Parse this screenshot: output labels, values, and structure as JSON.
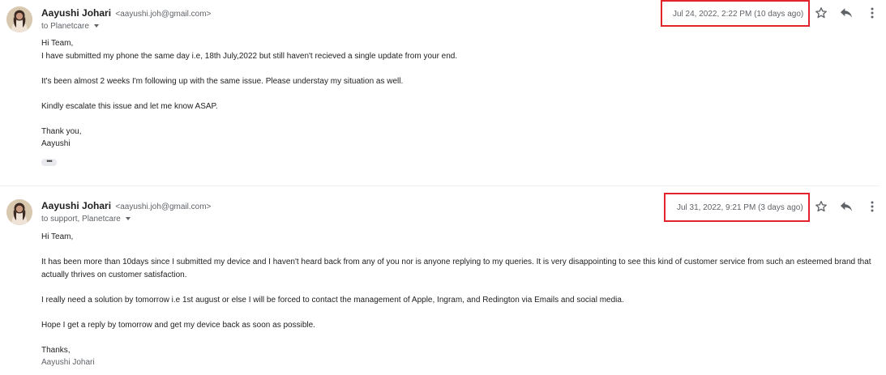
{
  "messages": [
    {
      "sender_name": "Aayushi Johari",
      "sender_email": "<aayushi.joh@gmail.com>",
      "recipients": "to Planetcare",
      "date": "Jul 24, 2022, 2:22 PM (10 days ago)",
      "body": [
        "Hi Team,",
        "I have submitted my phone the same day i.e, 18th July,2022 but still haven't recieved a single update from your end.",
        "It's been almost 2 weeks I'm following up with the same issue. Please understay my situation as well.",
        "Kindly escalate this issue and let me know ASAP.",
        "Thank you,",
        "Aayushi"
      ],
      "collapsed_label": "•••",
      "icons": [
        "star-icon",
        "reply-icon",
        "more-vert-icon"
      ]
    },
    {
      "sender_name": "Aayushi Johari",
      "sender_email": "<aayushi.joh@gmail.com>",
      "recipients": "to support, Planetcare",
      "date": "Jul 31, 2022, 9:21 PM (3 days ago)",
      "body": [
        "Hi Team,",
        "It has been more than 10days since I submitted my device and I haven't heard back from any of you nor is anyone replying to my queries. It is very disappointing to see this kind of customer service from such an esteemed brand that actually thrives on customer satisfaction.",
        "I really need a solution by tomorrow i.e 1st august or else I will be forced to contact the management of Apple, Ingram, and Redington via Emails and social media.",
        "Hope I get a reply by tomorrow and get my device back as soon as possible.",
        "Thanks,",
        "Aayushi Johari"
      ],
      "icons": [
        "star-icon",
        "reply-icon",
        "more-vert-icon"
      ]
    }
  ],
  "colors": {
    "highlight_box": "#e2232c",
    "text_primary": "#222222",
    "text_secondary": "#5f6368"
  }
}
